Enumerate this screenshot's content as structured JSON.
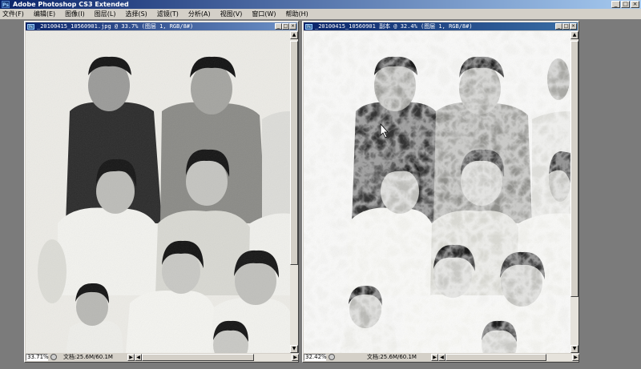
{
  "app": {
    "logo": "Ps",
    "title": "Adobe Photoshop CS3 Extended",
    "controls": [
      "_",
      "□",
      "×"
    ]
  },
  "menu": {
    "items": [
      "文件(F)",
      "编辑(E)",
      "图像(I)",
      "图层(L)",
      "选择(S)",
      "滤镜(T)",
      "分析(A)",
      "视图(V)",
      "窗口(W)",
      "帮助(H)"
    ]
  },
  "doc_left": {
    "icon": "Ps",
    "title": "_20100415_10560901.jpg @ 33.7% (图层 1, RGB/8#)",
    "zoom": "33.71%",
    "docsize": "文档:25.6M/60.1M",
    "controls": [
      "_",
      "□",
      "×"
    ]
  },
  "doc_right": {
    "icon": "Ps",
    "title": "_20100415_10560901 副本 @ 32.4% (图层 1, RGB/8#)",
    "zoom": "32.42%",
    "docsize": "文档:25.6M/60.1M",
    "controls": [
      "_",
      "□",
      "×"
    ]
  },
  "colors": {
    "title_active": "#0a246a",
    "chrome": "#d4d0c8",
    "workspace": "#7b7b7b"
  }
}
